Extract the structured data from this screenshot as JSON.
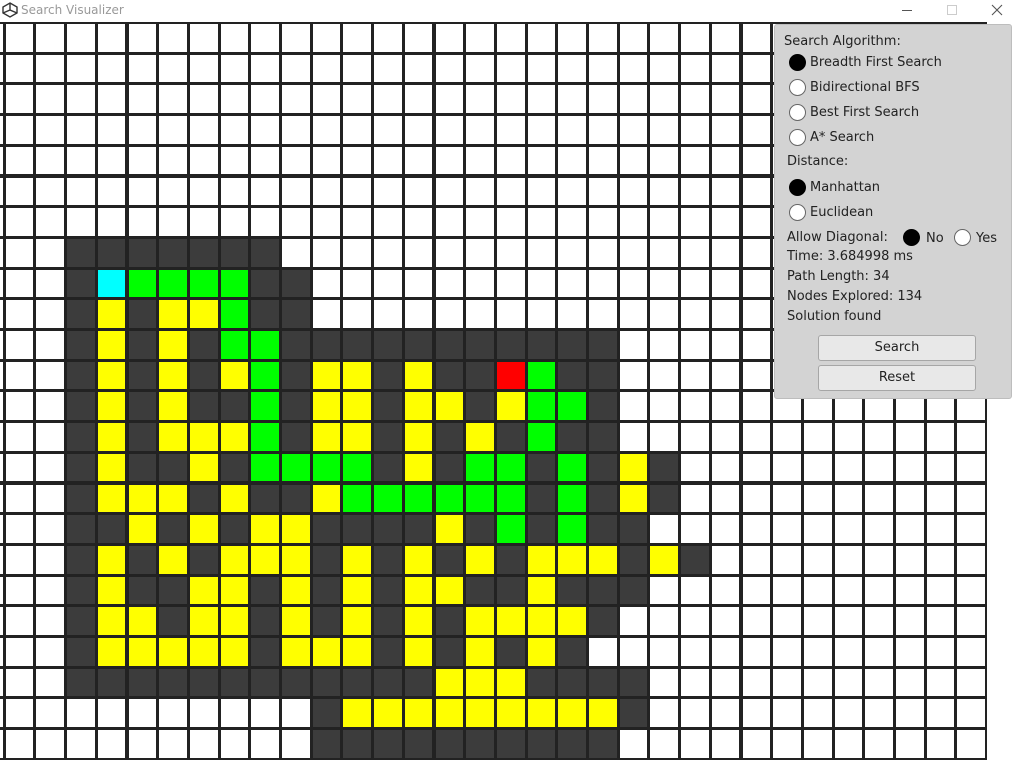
{
  "window": {
    "title": "Search Visualizer",
    "controls": [
      "minimize-icon",
      "maximize-icon",
      "close-icon"
    ]
  },
  "colors": {
    "empty": "#ffffff",
    "wall": "#3c3c3c",
    "explored": "#ffff00",
    "path": "#00ff00",
    "start": "#00ffff",
    "goal": "#ff0000",
    "gridline": "#222222"
  },
  "grid": {
    "legend": {
      ".": "empty",
      "#": "wall",
      "y": "explored",
      "g": "path",
      "S": "start",
      "G": "goal"
    },
    "rows": [
      "................................",
      "................................",
      "................................",
      "................................",
      "................................",
      "................................",
      "................................",
      "...#######......................",
      "...#Sgggg##.....................",
      "...#y#yyg##.....................",
      "...#y#y#gg###########...........",
      "...#y#y#yg#yy#y##Gg##...........",
      "...#y#y##g#yy#yy#ygg#...........",
      "...#y#yyyg#yy#y#y#g##...........",
      "...#y##y#gggg#y#gg#g#y#.........",
      "...#yyy#y##ygggggg#g#y#.........",
      "...##y#y#yy####y#g#g##..........",
      "...#y#y#yyy#y#y#y#yyy#y#........",
      "...#y##yy#y#y#yy##y###..........",
      "...#yy#yy#y#y#y#yyyy#...........",
      "...#yyyyy#yyy#y#y#y#............",
      "...############yyy####..........",
      "...........#yyyyyyyyy#..........",
      "...........##########..........."
    ]
  },
  "panel": {
    "algorithm_label": "Search Algorithm:",
    "algorithms": [
      {
        "label": "Breadth First Search",
        "selected": true
      },
      {
        "label": "Bidirectional BFS",
        "selected": false
      },
      {
        "label": "Best First Search",
        "selected": false
      },
      {
        "label": "A* Search",
        "selected": false
      }
    ],
    "distance_label": "Distance:",
    "distances": [
      {
        "label": "Manhattan",
        "selected": true
      },
      {
        "label": "Euclidean",
        "selected": false
      }
    ],
    "diagonal_label": "Allow Diagonal:",
    "diagonal_options": [
      {
        "label": "No",
        "selected": true
      },
      {
        "label": "Yes",
        "selected": false
      }
    ],
    "time_text": "Time: 3.684998 ms",
    "path_length_text": "Path Length: 34",
    "nodes_explored_text": "Nodes Explored: 134",
    "status_text": "Solution found",
    "search_button": "Search",
    "reset_button": "Reset"
  }
}
